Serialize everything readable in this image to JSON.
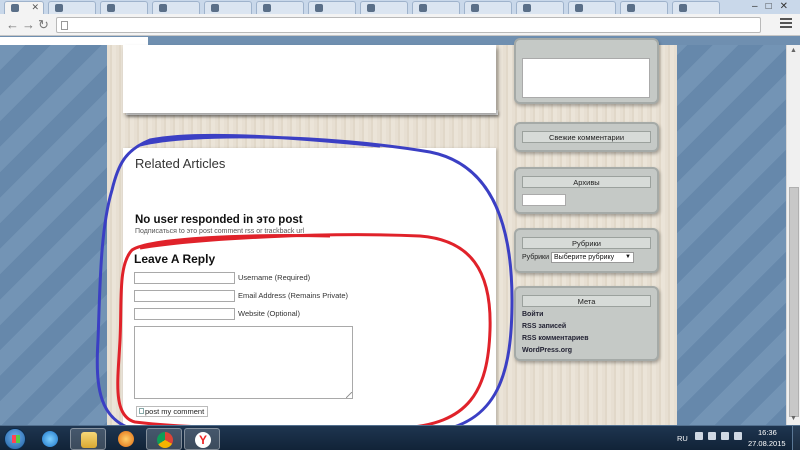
{
  "browser": {
    "tabs": [
      {
        "label": ""
      },
      {
        "label": ""
      },
      {
        "label": ""
      },
      {
        "label": ""
      },
      {
        "label": ""
      },
      {
        "label": ""
      },
      {
        "label": ""
      },
      {
        "label": ""
      },
      {
        "label": ""
      },
      {
        "label": ""
      },
      {
        "label": ""
      },
      {
        "label": ""
      },
      {
        "label": ""
      },
      {
        "label": ""
      },
      {
        "label": ""
      }
    ],
    "url": ""
  },
  "article": {
    "related_title": "Related Articles",
    "no_user_text": "No user responded in это post",
    "subscribe_text": "Подписаться to это post comment rss or trackback url"
  },
  "reply_form": {
    "title": "Leave A Reply",
    "username_label": "Username (Required)",
    "email_label": "Email Address (Remains Private)",
    "website_label": "Website (Optional)",
    "username_value": "",
    "email_value": "",
    "website_value": "",
    "comment_value": "",
    "submit_label": "post my comment"
  },
  "sidebar": {
    "recent_comments_title": "Свежие комментарии",
    "archives_title": "Архивы",
    "categories_title": "Рубрики",
    "categories_label": "Рубрики",
    "categories_select": "Выберите рубрику",
    "meta_title": "Мета",
    "meta_links": [
      "Войти",
      "RSS записей",
      "RSS комментариев",
      "WordPress.org"
    ]
  },
  "taskbar": {
    "language": "RU",
    "time": "16:36",
    "date": "27.08.2015"
  },
  "colors": {
    "annotation_blue": "#3b3fc4",
    "annotation_red": "#e0222a"
  }
}
